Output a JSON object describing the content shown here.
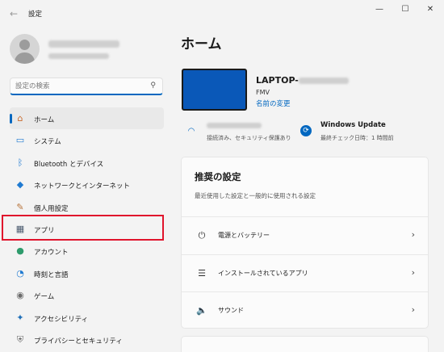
{
  "window": {
    "title": "設定",
    "back_glyph": "←",
    "minimize_glyph": "—",
    "maximize_glyph": "☐",
    "close_glyph": "✕"
  },
  "search": {
    "placeholder": "設定の検索",
    "icon": "search-icon"
  },
  "sidebar": {
    "items": [
      {
        "label": "ホーム",
        "icon": "home-icon",
        "glyph": "⌂",
        "color": "#c96a2b",
        "selected": true
      },
      {
        "label": "システム",
        "icon": "monitor-icon",
        "glyph": "▭",
        "color": "#1f7ad1",
        "selected": false
      },
      {
        "label": "Bluetooth とデバイス",
        "icon": "bluetooth-icon",
        "glyph": "ᛒ",
        "color": "#1f7ad1",
        "selected": false
      },
      {
        "label": "ネットワークとインターネット",
        "icon": "wifi-icon",
        "glyph": "◆",
        "color": "#1f7ad1",
        "selected": false
      },
      {
        "label": "個人用設定",
        "icon": "brush-icon",
        "glyph": "✎",
        "color": "#b8733a",
        "selected": false
      },
      {
        "label": "アプリ",
        "icon": "apps-icon",
        "glyph": "▦",
        "color": "#4a5a6e",
        "selected": false
      },
      {
        "label": "アカウント",
        "icon": "account-icon",
        "glyph": "●",
        "color": "#2e9b6c",
        "selected": false
      },
      {
        "label": "時刻と言語",
        "icon": "clock-globe-icon",
        "glyph": "◔",
        "color": "#1f7ad1",
        "selected": false
      },
      {
        "label": "ゲーム",
        "icon": "gamepad-icon",
        "glyph": "◉",
        "color": "#6b6b6b",
        "selected": false
      },
      {
        "label": "アクセシビリティ",
        "icon": "accessibility-icon",
        "glyph": "✦",
        "color": "#1f6fb8",
        "selected": false
      },
      {
        "label": "プライバシーとセキュリティ",
        "icon": "shield-icon",
        "glyph": "⛨",
        "color": "#6b6b6b",
        "selected": false
      }
    ]
  },
  "main": {
    "title": "ホーム",
    "device": {
      "name": "LAPTOP-",
      "maker": "FMV",
      "rename_link": "名前の変更"
    },
    "network": {
      "status": "接続済み、セキュリティ保護あり",
      "icon": "wifi-icon"
    },
    "windows_update": {
      "title": "Windows Update",
      "last_checked": "最終チェック日時：1 時間前",
      "icon": "sync-icon"
    },
    "recommended": {
      "title": "推奨の設定",
      "subtitle": "最近使用した設定と一般的に使用される設定",
      "rows": [
        {
          "label": "電源とバッテリー",
          "icon": "power-icon",
          "glyph": "⏻"
        },
        {
          "label": "インストールされているアプリ",
          "icon": "app-list-icon",
          "glyph": "☰"
        },
        {
          "label": "サウンド",
          "icon": "speaker-icon",
          "glyph": "🔈"
        }
      ],
      "chevron": "›"
    }
  },
  "colors": {
    "accent": "#0067c0",
    "highlight": "#e0142c",
    "device_screen": "#0a58b8"
  }
}
